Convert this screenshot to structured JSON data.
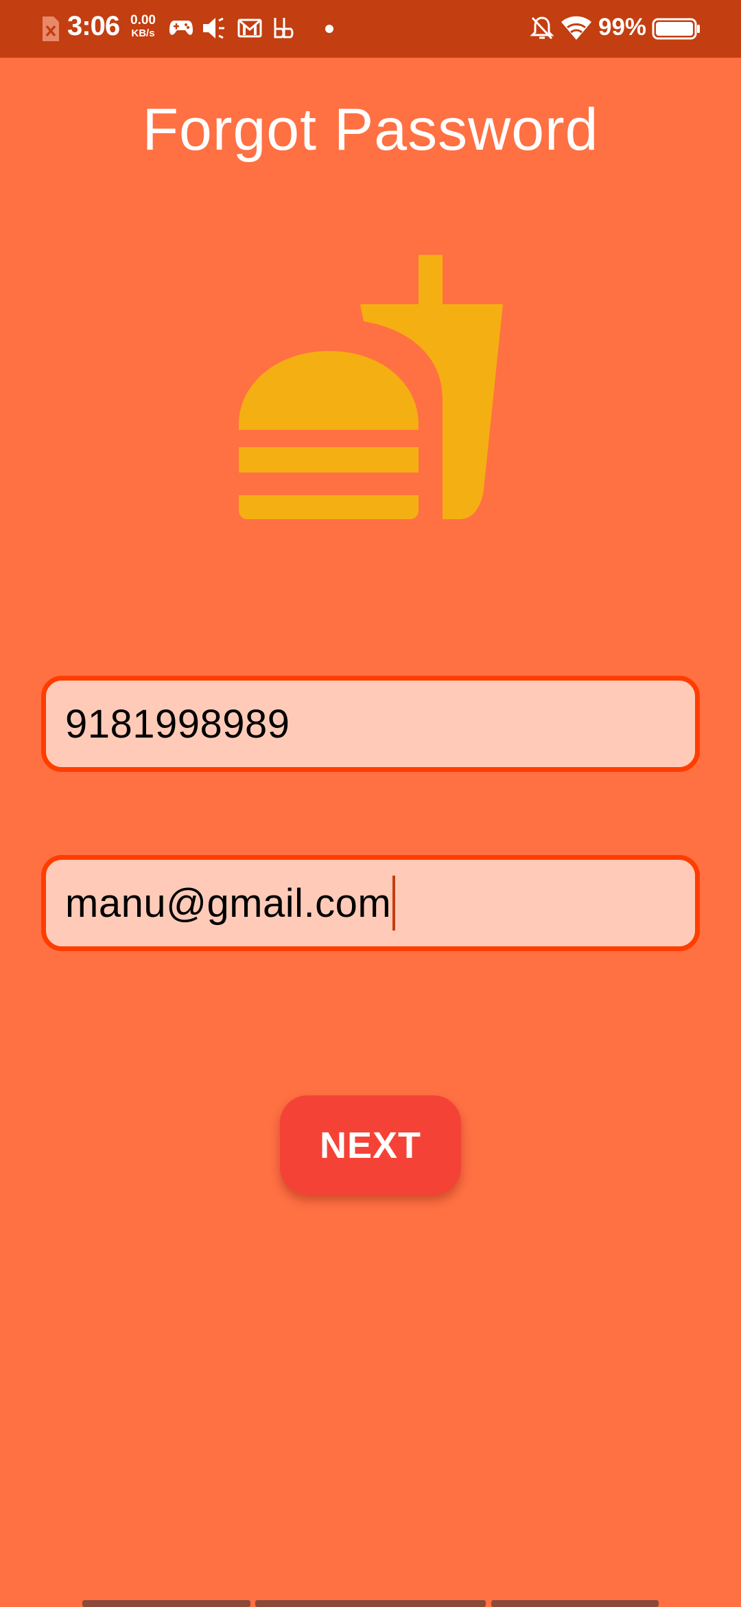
{
  "status_bar": {
    "time": "3:06",
    "net_speed_value": "0.00",
    "net_speed_unit": "KB/s",
    "battery_percent": "99%",
    "icons": [
      "sim-error-icon",
      "game-controller-icon",
      "speaker-muted-icon",
      "gmail-icon",
      "bb-icon",
      "notification-dot",
      "bell-off-icon",
      "wifi-icon",
      "battery-icon"
    ]
  },
  "page": {
    "title": "Forgot Password",
    "logo_icon": "fastfood-icon",
    "logo_color": "#F4AF12"
  },
  "form": {
    "phone_value": "9181998989",
    "email_value": "manu@gmail.com",
    "next_label": "NEXT"
  },
  "colors": {
    "background": "#FF7043",
    "status_bar": "#C33E10",
    "field_border": "#FF3D00",
    "field_fill": "#FFCBB8",
    "button": "#F44336"
  }
}
